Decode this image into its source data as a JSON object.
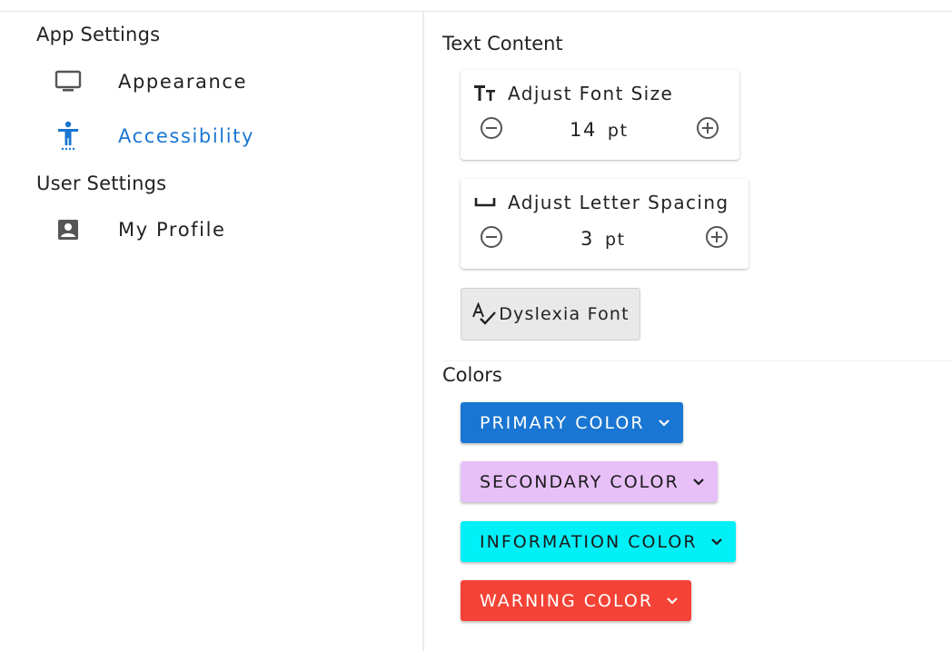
{
  "sidebar": {
    "sections": [
      {
        "title": "App Settings",
        "items": [
          {
            "label": "Appearance",
            "icon": "monitor-icon",
            "active": false
          },
          {
            "label": "Accessibility",
            "icon": "accessibility-icon",
            "active": true
          }
        ]
      },
      {
        "title": "User Settings",
        "items": [
          {
            "label": "My Profile",
            "icon": "account-box-icon",
            "active": false
          }
        ]
      }
    ]
  },
  "main": {
    "text_content": {
      "heading": "Text Content",
      "font_size": {
        "title": "Adjust Font Size",
        "value": "14",
        "unit": "pt",
        "icon": "format-size-icon"
      },
      "letter_spacing": {
        "title": "Adjust Letter Spacing",
        "value": "3",
        "unit": "pt",
        "icon": "space-bar-icon"
      },
      "dyslexia_font": {
        "label": "Dyslexia Font",
        "icon": "spellcheck-icon"
      }
    },
    "colors": {
      "heading": "Colors",
      "buttons": [
        {
          "label": "PRIMARY COLOR",
          "bg": "#1976d2",
          "fg": "#ffffff"
        },
        {
          "label": "SECONDARY COLOR",
          "bg": "#e8c0f8",
          "fg": "#1b1b1b"
        },
        {
          "label": "INFORMATION COLOR",
          "bg": "#00f0f8",
          "fg": "#1b1b1b"
        },
        {
          "label": "WARNING COLOR",
          "bg": "#f44336",
          "fg": "#ffffff"
        }
      ]
    }
  },
  "theme": {
    "accent": "#1976d2",
    "icon_gray": "#555555"
  }
}
